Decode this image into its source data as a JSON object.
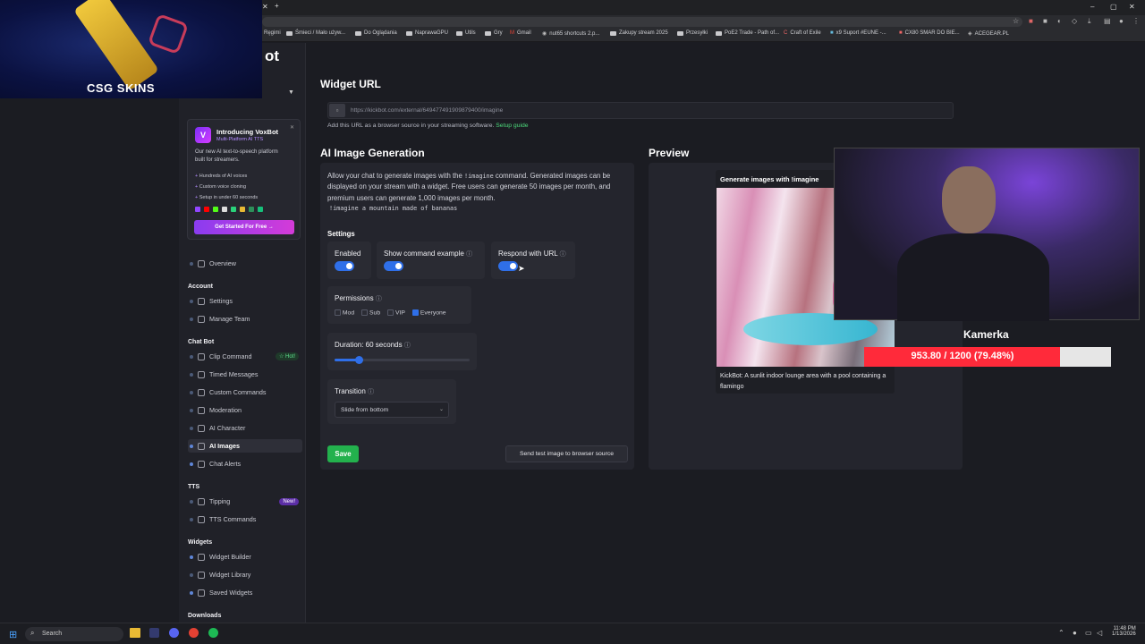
{
  "browser": {
    "new_tab": "+",
    "bookmarks": [
      "Śmieci / Mało używ...",
      "Do Oglądania",
      "NaprawaGPU",
      "Utils",
      "Gry",
      "Gmail",
      "nut65 shortcuts 2.p...",
      "Zakupy stream 2025",
      "Przesyłki",
      "PoE2 Trade - Path of...",
      "Craft of Exile",
      "x9 Suport #EUNE -...",
      "CX80 SMAR DO BIE...",
      "ACEGEAR.PL"
    ],
    "bookmark_first_partial": "Ręgimi",
    "window_controls": [
      "–",
      "▢",
      "✕"
    ]
  },
  "overlay_skins": {
    "brand": "CSG SKINS"
  },
  "logo_partial": "ot",
  "promo": {
    "title": "Introducing VoxBot",
    "subtitle": "Multi-Platform AI TTS",
    "description": "Our new AI text-to-speech platform built for streamers.",
    "features": [
      "Hundreds of AI voices",
      "Custom voice cloning",
      "Setup in under 60 seconds"
    ],
    "cta": "Get Started For Free →",
    "close": "✕"
  },
  "sidebar": {
    "overview": "Overview",
    "account_title": "Account",
    "account": [
      "Settings",
      "Manage Team"
    ],
    "chatbot_title": "Chat Bot",
    "chatbot": [
      "Clip Command",
      "Timed Messages",
      "Custom Commands",
      "Moderation",
      "AI Character",
      "AI Images",
      "Chat Alerts"
    ],
    "hot_badge": "☆ Hot!",
    "tts_title": "TTS",
    "tts": [
      "Tipping",
      "TTS Commands"
    ],
    "new_badge": "New!",
    "widgets_title": "Widgets",
    "widgets": [
      "Widget Builder",
      "Widget Library",
      "Saved Widgets"
    ],
    "downloads_title": "Downloads"
  },
  "widget_url": {
    "title": "Widget URL",
    "url": "https://kickbot.com/external/649477491909879400/imagine",
    "hint": "Add this URL as a browser source in your streaming software.",
    "setup_link": "Setup guide"
  },
  "ai_images": {
    "title": "AI Image Generation",
    "desc_1": "Allow your chat to generate images with the",
    "command": "!imagine",
    "desc_2": "command. Generated images can be displayed on your stream with a widget. Free users can generate 50 images per month, and premium users can generate 1,000 images per month.",
    "example": "!imagine a mountain made of bananas",
    "settings_title": "Settings",
    "enabled": "Enabled",
    "show_cmd": "Show command example",
    "respond_url": "Respond with URL",
    "info_icon": "ⓘ",
    "permissions": "Permissions",
    "perm_opts": [
      "Mod",
      "Sub",
      "VIP",
      "Everyone"
    ],
    "duration": "Duration: 60 seconds",
    "duration_fraction": 0.18,
    "transition": "Transition",
    "transition_value": "Slide from bottom",
    "save": "Save",
    "send_test": "Send test image to browser source"
  },
  "preview": {
    "title": "Preview",
    "heading": "Generate images with !imagine",
    "caption": "KickBot: A sunlit indoor lounge area with a pool containing a flamingo"
  },
  "webcam": {
    "label": "Kamerka",
    "progress_text": "953.80 / 1200 (79.48%)",
    "progress_fraction": 0.7948
  },
  "taskbar": {
    "search": "Search",
    "time": "11:48 PM",
    "date": "1/13/2026"
  }
}
